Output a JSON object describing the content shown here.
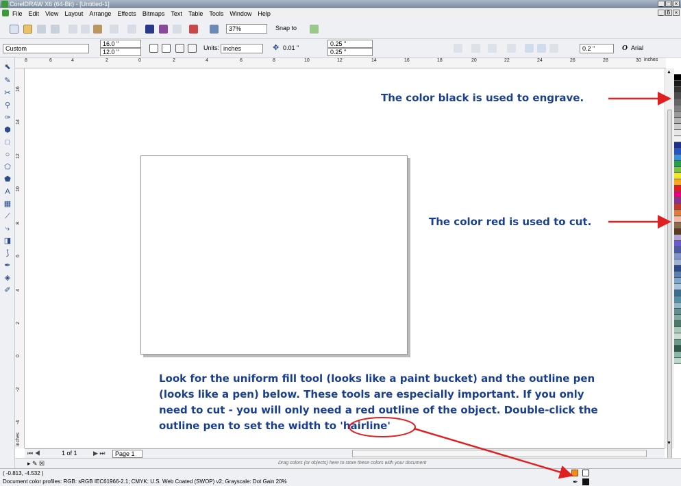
{
  "window": {
    "title": "CorelDRAW X6 (64-Bit) - [Untitled-1]",
    "controls": [
      "_",
      "□",
      "×"
    ],
    "doc_controls": [
      "_",
      "ƃ",
      "×"
    ]
  },
  "menu": [
    "File",
    "Edit",
    "View",
    "Layout",
    "Arrange",
    "Effects",
    "Bitmaps",
    "Text",
    "Table",
    "Tools",
    "Window",
    "Help"
  ],
  "toolbar": {
    "zoom": "37%",
    "snap_to": "Snap to"
  },
  "property_bar": {
    "page_size": "Custom",
    "width": "16.0 \"",
    "height": "12.0 \"",
    "units_label": "Units:",
    "units": "inches",
    "nudge": "0.01 \"",
    "dup_x": "0.25 \"",
    "dup_y": "0.25 \"",
    "outline_width": "0.2 \"",
    "font": "Arial"
  },
  "ruler": {
    "h_ticks": [
      "8",
      "6",
      "4",
      "2",
      "0",
      "2",
      "4",
      "6",
      "8",
      "10",
      "12",
      "14",
      "16",
      "18",
      "20",
      "22",
      "24",
      "26",
      "28",
      "30"
    ],
    "units": "inches",
    "v_ticks": [
      "16",
      "14",
      "12",
      "10",
      "8",
      "6",
      "4",
      "2",
      "0",
      "-2",
      "-4"
    ],
    "v_units": "inches"
  },
  "annotations": {
    "black": "The color black is used to engrave.",
    "red": "The color red is used to cut.",
    "tools": [
      "Look for the uniform fill tool (looks like a paint bucket) and the outline pen",
      "(looks like a pen) below.  These tools are especially important.  If you only",
      "need to cut - you will only need a red outline of the object.  Double-click the",
      "outline pen to set the width to "
    ],
    "hairline": "'hairline'",
    "accent": "#e02020",
    "text_color": "#1a3f8f"
  },
  "page_nav": {
    "count": "1 of 1",
    "tab": "Page 1"
  },
  "doc_palette_hint": "Drag colors (or objects) here to store these colors with your document",
  "status": {
    "coords": "( -0.813, -4.532 )",
    "profiles": "Document color profiles: RGB: sRGB IEC61966-2.1; CMYK: U.S. Web Coated (SWOP) v2; Grayscale: Dot Gain 20%"
  },
  "palette_colors": [
    "#ffffff",
    "#000000",
    "#1a1a1a",
    "#333333",
    "#4d4d4d",
    "#666666",
    "#808080",
    "#999999",
    "#b3b3b3",
    "#cccccc",
    "#e6e6e6",
    "#f2f2f2",
    "#1f2f8f",
    "#2255cc",
    "#3d8fd8",
    "#23a04a",
    "#7ac143",
    "#f3ea1d",
    "#f7a81b",
    "#e41a1c",
    "#e5007e",
    "#8e2f8f",
    "#c0392b",
    "#e07b39",
    "#f5b7a8",
    "#8b6b4a",
    "#5c3b1e",
    "#b3a2d6",
    "#6a5acd",
    "#4b5aa6",
    "#7f92c9",
    "#9eb3d9",
    "#2e4a8a",
    "#5a7fb5",
    "#7ea6c8",
    "#a3c4dc",
    "#3a6f8f",
    "#4f8fa8",
    "#8fb8c8",
    "#5f8f8f",
    "#7fa8a0",
    "#4a7a6a",
    "#a8c8b8",
    "#c8dcd0",
    "#6a9a8a",
    "#2e5a4a",
    "#8ab8a8",
    "#b8d8c8"
  ]
}
